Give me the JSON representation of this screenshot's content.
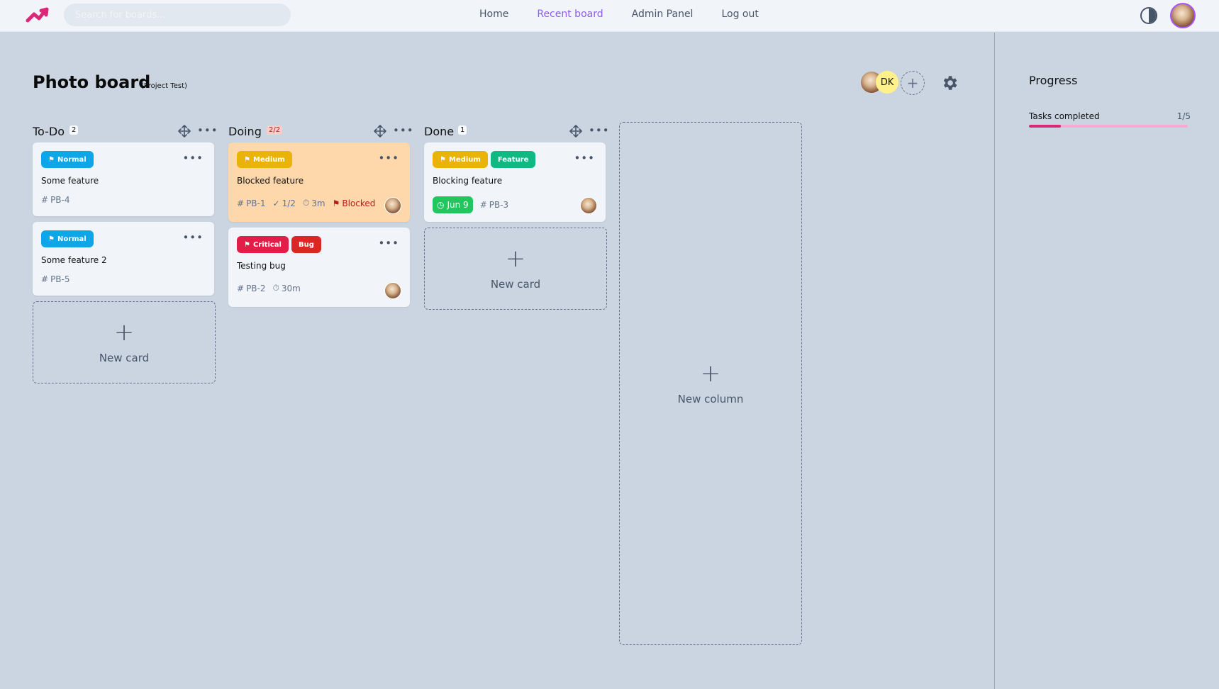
{
  "nav": {
    "search_placeholder": "Search for boards...",
    "links": [
      "Home",
      "Recent board",
      "Admin Panel",
      "Log out"
    ],
    "active_link": "Recent board",
    "icons": {
      "logo": "logo-icon",
      "theme": "contrast-icon",
      "avatar": "user-avatar"
    }
  },
  "board": {
    "title": "Photo board",
    "project": "(Project Test)",
    "member_initials": "DK",
    "add_member": "+"
  },
  "columns": [
    {
      "title": "To-Do",
      "count": "2",
      "cards": [
        {
          "tags": [
            "Normal"
          ],
          "title": "Some feature",
          "id": "PB-4"
        },
        {
          "tags": [
            "Normal"
          ],
          "title": "Some feature 2",
          "id": "PB-5"
        }
      ]
    },
    {
      "title": "Doing",
      "count": "2/2",
      "cards": [
        {
          "tags": [
            "Medium"
          ],
          "title": "Blocked feature",
          "id": "PB-1",
          "checklist": "1/2",
          "time": "3m",
          "blocked": "Blocked"
        },
        {
          "tags": [
            "Critical",
            "Bug"
          ],
          "title": "Testing bug",
          "id": "PB-2",
          "time": "30m"
        }
      ]
    },
    {
      "title": "Done",
      "count": "1",
      "cards": [
        {
          "tags": [
            "Medium",
            "Feature"
          ],
          "title": "Blocking feature",
          "id": "PB-3",
          "due": "Jun 9"
        }
      ]
    }
  ],
  "new_card_label": "New card",
  "new_column_label": "New column",
  "sidebar": {
    "title": "Progress",
    "tasks_label": "Tasks completed",
    "tasks_value": "1/5",
    "progress_fraction": 0.2
  },
  "colors": {
    "normal": "#0ea5e9",
    "medium": "#eab308",
    "critical": "#e11d48",
    "bug": "#dc2626",
    "feature": "#10b981",
    "accent": "#8b5cf6",
    "progress": "#db2777"
  }
}
